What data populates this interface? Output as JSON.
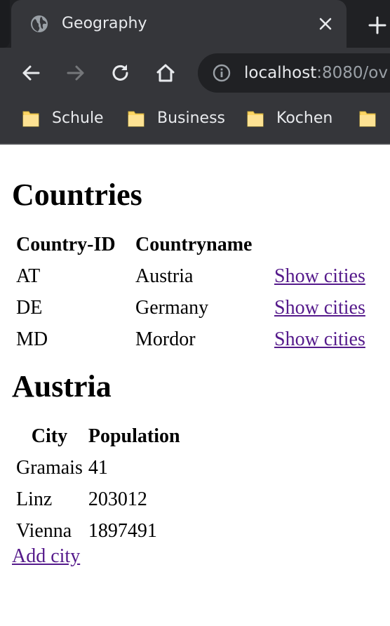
{
  "browser": {
    "tab": {
      "title": "Geography",
      "favicon": "globe-icon"
    },
    "address": {
      "host": "localhost",
      "rest": ":8080/ov"
    },
    "bookmarks": [
      {
        "label": "Schule"
      },
      {
        "label": "Business"
      },
      {
        "label": "Kochen"
      },
      {
        "label": ""
      }
    ],
    "colors": {
      "frame": "#202124",
      "toolbar": "#35363a",
      "folder": "#fdd663"
    }
  },
  "countries": {
    "heading": "Countries",
    "columns": [
      "Country-ID",
      "Countryname",
      ""
    ],
    "rows": [
      {
        "id": "AT",
        "name": "Austria",
        "action": "Show cities"
      },
      {
        "id": "DE",
        "name": "Germany",
        "action": "Show cities"
      },
      {
        "id": "MD",
        "name": "Mordor",
        "action": "Show cities"
      }
    ]
  },
  "selected_country": {
    "heading": "Austria",
    "columns": [
      "City",
      "Population"
    ],
    "rows": [
      {
        "city": "Gramais",
        "population": "41"
      },
      {
        "city": "Linz",
        "population": "203012"
      },
      {
        "city": "Vienna",
        "population": "1897491"
      }
    ],
    "add_link": "Add city"
  }
}
